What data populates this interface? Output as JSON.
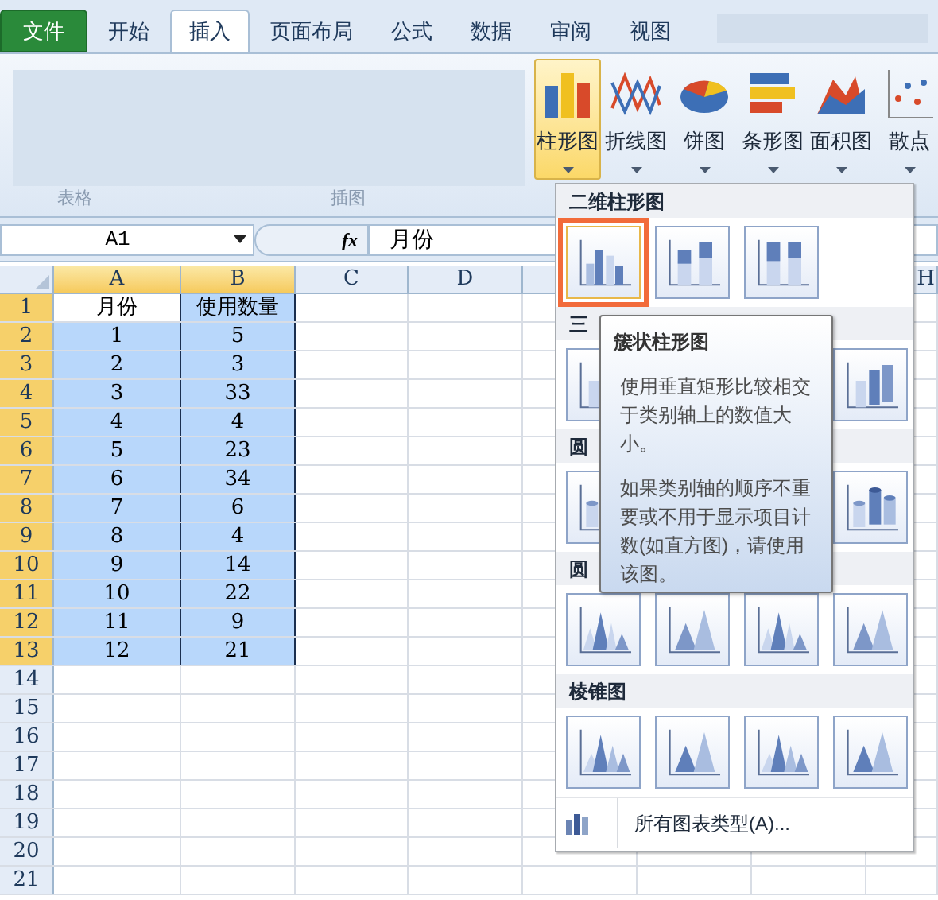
{
  "ribbon": {
    "tabs": [
      {
        "label": "文件",
        "kind": "file",
        "selected": false
      },
      {
        "label": "开始",
        "kind": "tab",
        "selected": false
      },
      {
        "label": "插入",
        "kind": "tab",
        "selected": true
      },
      {
        "label": "页面布局",
        "kind": "tab",
        "selected": false
      },
      {
        "label": "公式",
        "kind": "tab",
        "selected": false
      },
      {
        "label": "数据",
        "kind": "tab",
        "selected": false
      },
      {
        "label": "审阅",
        "kind": "tab",
        "selected": false
      },
      {
        "label": "视图",
        "kind": "tab",
        "selected": false
      }
    ],
    "groups": [
      {
        "label": "表格"
      },
      {
        "label": "插图"
      }
    ],
    "chart_buttons": [
      {
        "label": "柱形图",
        "kind": "column",
        "selected": true
      },
      {
        "label": "折线图",
        "kind": "line",
        "selected": false
      },
      {
        "label": "饼图",
        "kind": "pie",
        "selected": false
      },
      {
        "label": "条形图",
        "kind": "bar",
        "selected": false
      },
      {
        "label": "面积图",
        "kind": "area",
        "selected": false
      },
      {
        "label": "散点",
        "kind": "scatter",
        "selected": false
      }
    ]
  },
  "formula_bar": {
    "name_box": "A1",
    "function_label": "fx",
    "value": "月份"
  },
  "sheet": {
    "columns": [
      {
        "label": "A",
        "selected": true
      },
      {
        "label": "B",
        "selected": true
      },
      {
        "label": "C",
        "selected": false
      },
      {
        "label": "D",
        "selected": false
      },
      {
        "label": "H",
        "selected": false
      }
    ],
    "rows": [
      {
        "header": "1",
        "selected": true,
        "cells": [
          {
            "value": "月份",
            "selected": false
          },
          {
            "value": "使用数量",
            "selected": true
          }
        ]
      },
      {
        "header": "2",
        "selected": true,
        "cells": [
          {
            "value": "1",
            "selected": true
          },
          {
            "value": "5",
            "selected": true
          }
        ]
      },
      {
        "header": "3",
        "selected": true,
        "cells": [
          {
            "value": "2",
            "selected": true
          },
          {
            "value": "3",
            "selected": true
          }
        ]
      },
      {
        "header": "4",
        "selected": true,
        "cells": [
          {
            "value": "3",
            "selected": true
          },
          {
            "value": "33",
            "selected": true
          }
        ]
      },
      {
        "header": "5",
        "selected": true,
        "cells": [
          {
            "value": "4",
            "selected": true
          },
          {
            "value": "4",
            "selected": true
          }
        ]
      },
      {
        "header": "6",
        "selected": true,
        "cells": [
          {
            "value": "5",
            "selected": true
          },
          {
            "value": "23",
            "selected": true
          }
        ]
      },
      {
        "header": "7",
        "selected": true,
        "cells": [
          {
            "value": "6",
            "selected": true
          },
          {
            "value": "34",
            "selected": true
          }
        ]
      },
      {
        "header": "8",
        "selected": true,
        "cells": [
          {
            "value": "7",
            "selected": true
          },
          {
            "value": "6",
            "selected": true
          }
        ]
      },
      {
        "header": "9",
        "selected": true,
        "cells": [
          {
            "value": "8",
            "selected": true
          },
          {
            "value": "4",
            "selected": true
          }
        ]
      },
      {
        "header": "10",
        "selected": true,
        "cells": [
          {
            "value": "9",
            "selected": true
          },
          {
            "value": "14",
            "selected": true
          }
        ]
      },
      {
        "header": "11",
        "selected": true,
        "cells": [
          {
            "value": "10",
            "selected": true
          },
          {
            "value": "22",
            "selected": true
          }
        ]
      },
      {
        "header": "12",
        "selected": true,
        "cells": [
          {
            "value": "11",
            "selected": true
          },
          {
            "value": "9",
            "selected": true
          }
        ]
      },
      {
        "header": "13",
        "selected": true,
        "cells": [
          {
            "value": "12",
            "selected": true
          },
          {
            "value": "21",
            "selected": true
          }
        ]
      },
      {
        "header": "14",
        "selected": false
      },
      {
        "header": "15",
        "selected": false
      },
      {
        "header": "16",
        "selected": false
      },
      {
        "header": "17",
        "selected": false
      },
      {
        "header": "18",
        "selected": false
      },
      {
        "header": "19",
        "selected": false
      },
      {
        "header": "20",
        "selected": false
      },
      {
        "header": "21",
        "selected": false
      }
    ]
  },
  "gallery": {
    "sections": [
      {
        "title": "二维柱形图",
        "kind": "column2d",
        "covered": false,
        "icons": [
          {
            "selected": true
          },
          {
            "selected": false
          },
          {
            "selected": false
          }
        ]
      },
      {
        "title": "三",
        "kind": "column3d",
        "covered": true,
        "icons": [
          {
            "selected": false
          },
          {
            "selected": false
          }
        ]
      },
      {
        "title": "圆",
        "kind": "cylinder",
        "covered": true,
        "icons": [
          {
            "selected": false
          },
          {
            "selected": false
          }
        ]
      },
      {
        "title": "圆",
        "kind": "cone",
        "covered": false,
        "icons": [
          {
            "selected": false
          },
          {
            "selected": false
          },
          {
            "selected": false
          },
          {
            "selected": false
          }
        ]
      },
      {
        "title": "棱锥图",
        "kind": "pyramid",
        "covered": false,
        "icons": [
          {
            "selected": false
          },
          {
            "selected": false
          },
          {
            "selected": false
          },
          {
            "selected": false
          }
        ]
      }
    ],
    "footer": "所有图表类型(A)..."
  },
  "tooltip": {
    "title": "簇状柱形图",
    "paragraphs": [
      "使用垂直矩形比较相交于类别轴上的数值大小。",
      "如果类别轴的顺序不重要或不用于显示项目计数(如直方图)，请使用该图。"
    ]
  }
}
